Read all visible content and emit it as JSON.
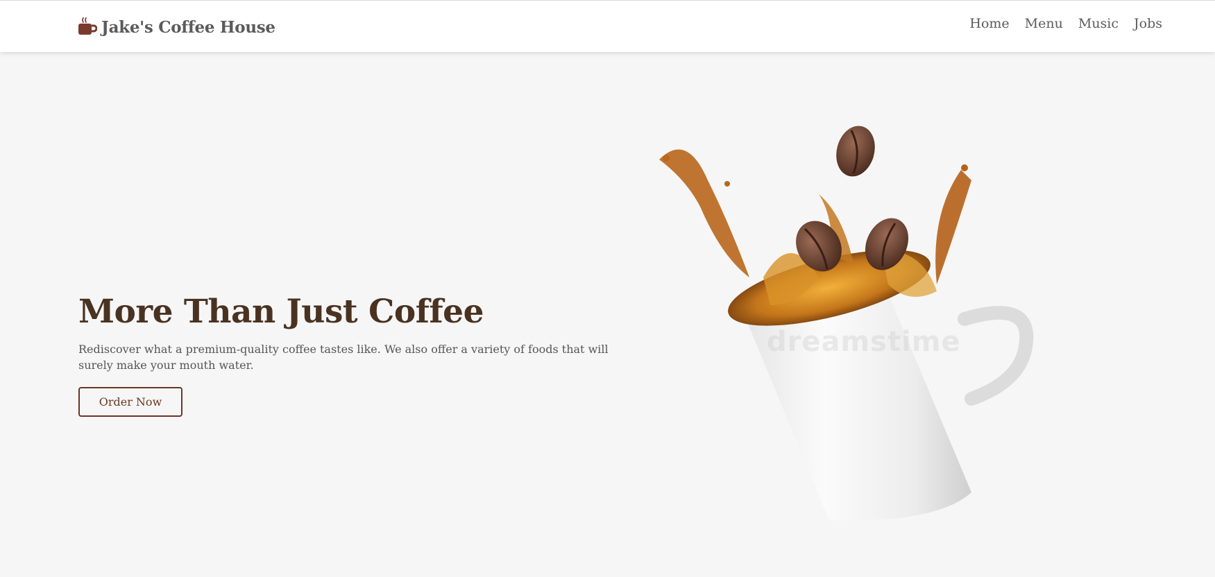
{
  "header": {
    "brand_name": "Jake's Coffee House",
    "brand_icon": "coffee-cup-icon",
    "nav": [
      {
        "label": "Home"
      },
      {
        "label": "Menu"
      },
      {
        "label": "Music"
      },
      {
        "label": "Jobs"
      }
    ]
  },
  "hero": {
    "title": "More Than Just Coffee",
    "subtitle": "Rediscover what a premium-quality coffee tastes like. We also offer a variety of foods that will surely make your mouth water.",
    "cta_label": "Order Now",
    "image_watermark": "dreamstime"
  },
  "colors": {
    "page_bg": "#f6f6f6",
    "nav_bg": "#ffffff",
    "title": "#4a3221",
    "accent": "#6b3525",
    "text": "#555555",
    "brand_icon": "#7a3a2c"
  }
}
